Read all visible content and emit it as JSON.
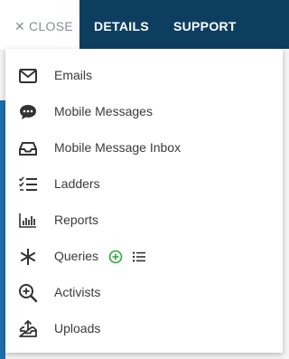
{
  "nav": {
    "close_label": "CLOSE",
    "close_icon": "close-icon",
    "details_label": "DETAILS",
    "support_label": "SUPPORT"
  },
  "menu": {
    "items": [
      {
        "label": "Emails",
        "icon": "envelope-icon"
      },
      {
        "label": "Mobile Messages",
        "icon": "chat-bubble-icon"
      },
      {
        "label": "Mobile Message Inbox",
        "icon": "inbox-tray-icon"
      },
      {
        "label": "Ladders",
        "icon": "checklist-icon"
      },
      {
        "label": "Reports",
        "icon": "bar-chart-icon"
      },
      {
        "label": "Queries",
        "icon": "asterisk-icon",
        "extra_icons": [
          "add-circle-icon",
          "list-icon"
        ]
      },
      {
        "label": "Activists",
        "icon": "zoom-in-icon"
      },
      {
        "label": "Uploads",
        "icon": "upload-tray-icon"
      }
    ]
  },
  "colors": {
    "topbar": "#0e3e5f",
    "accent_blue": "#1d5ea0",
    "add_green": "#2eaa3c",
    "text": "#3a3a3a"
  }
}
